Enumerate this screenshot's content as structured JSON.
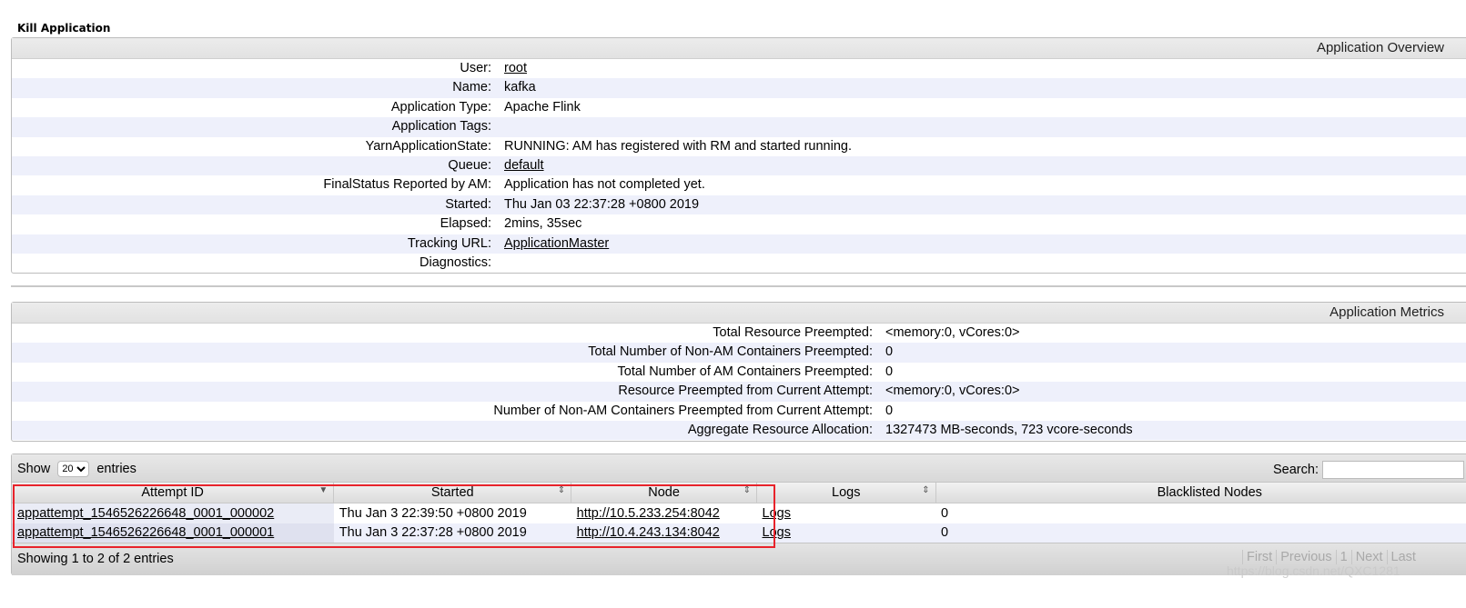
{
  "kill_label": "Kill Application",
  "overview": {
    "title": "Application Overview",
    "rows": [
      {
        "label": "User:",
        "value": "root",
        "link": true
      },
      {
        "label": "Name:",
        "value": "kafka",
        "link": false
      },
      {
        "label": "Application Type:",
        "value": "Apache Flink",
        "link": false
      },
      {
        "label": "Application Tags:",
        "value": "",
        "link": false
      },
      {
        "label": "YarnApplicationState:",
        "value": "RUNNING: AM has registered with RM and started running.",
        "link": false
      },
      {
        "label": "Queue:",
        "value": "default",
        "link": true
      },
      {
        "label": "FinalStatus Reported by AM:",
        "value": "Application has not completed yet.",
        "link": false
      },
      {
        "label": "Started:",
        "value": "Thu Jan 03 22:37:28 +0800 2019",
        "link": false
      },
      {
        "label": "Elapsed:",
        "value": "2mins, 35sec",
        "link": false
      },
      {
        "label": "Tracking URL:",
        "value": "ApplicationMaster",
        "link": true
      },
      {
        "label": "Diagnostics:",
        "value": "",
        "link": false
      }
    ]
  },
  "metrics": {
    "title": "Application Metrics",
    "rows": [
      {
        "label": "Total Resource Preempted:",
        "value": "<memory:0, vCores:0>"
      },
      {
        "label": "Total Number of Non-AM Containers Preempted:",
        "value": "0"
      },
      {
        "label": "Total Number of AM Containers Preempted:",
        "value": "0"
      },
      {
        "label": "Resource Preempted from Current Attempt:",
        "value": "<memory:0, vCores:0>"
      },
      {
        "label": "Number of Non-AM Containers Preempted from Current Attempt:",
        "value": "0"
      },
      {
        "label": "Aggregate Resource Allocation:",
        "value": "1327473 MB-seconds, 723 vcore-seconds"
      }
    ]
  },
  "attempts": {
    "show_label": "Show",
    "entries_label": "entries",
    "page_size": "20",
    "search_label": "Search:",
    "columns": [
      "Attempt ID",
      "Started",
      "Node",
      "Logs",
      "Blacklisted Nodes"
    ],
    "rows": [
      {
        "id": "appattempt_1546526226648_0001_000002",
        "started": "Thu Jan 3 22:39:50 +0800 2019",
        "node": "http://10.5.233.254:8042",
        "logs": "Logs",
        "blacklisted": "0"
      },
      {
        "id": "appattempt_1546526226648_0001_000001",
        "started": "Thu Jan 3 22:37:28 +0800 2019",
        "node": "http://10.4.243.134:8042",
        "logs": "Logs",
        "blacklisted": "0"
      }
    ],
    "info": "Showing 1 to 2 of 2 entries",
    "pager": {
      "first": "First",
      "previous": "Previous",
      "page": "1",
      "next": "Next",
      "last": "Last"
    }
  },
  "watermark": "https://blog.csdn.net/QXC1281"
}
